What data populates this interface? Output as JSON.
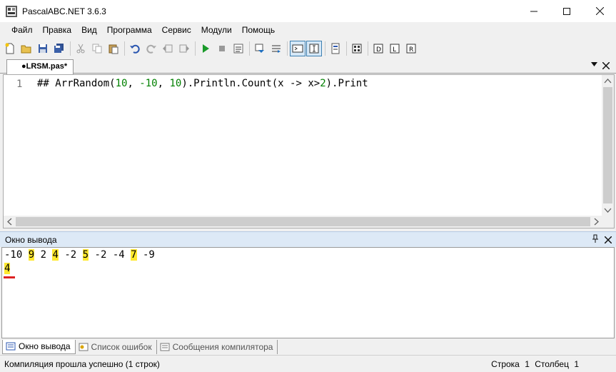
{
  "window": {
    "title": "PascalABC.NET 3.6.3",
    "minimize": "—",
    "maximize": "☐",
    "close": "✕"
  },
  "menu": [
    "Файл",
    "Правка",
    "Вид",
    "Программа",
    "Сервис",
    "Модули",
    "Помощь"
  ],
  "editor": {
    "tab_label": "●LRSM.pas*",
    "line_number": "1",
    "code_prefix": "## ArrRandom(",
    "code_n1": "10",
    "code_mid1": ", ",
    "code_n2": "-10",
    "code_mid2": ", ",
    "code_n3": "10",
    "code_mid3": ").Println.Count(x -> x>",
    "code_n4": "2",
    "code_suffix": ").Print"
  },
  "output": {
    "title": "Окно вывода",
    "line1": [
      {
        "text": "-10",
        "highlight": false
      },
      {
        "text": "9",
        "highlight": true
      },
      {
        "text": "2",
        "highlight": false
      },
      {
        "text": "4",
        "highlight": true
      },
      {
        "text": "-2",
        "highlight": false
      },
      {
        "text": "5",
        "highlight": true
      },
      {
        "text": "-2",
        "highlight": false
      },
      {
        "text": "-4",
        "highlight": false
      },
      {
        "text": "7",
        "highlight": true
      },
      {
        "text": "-9",
        "highlight": false
      }
    ],
    "result": "4"
  },
  "bottom_tabs": {
    "output": "Окно вывода",
    "errors": "Список ошибок",
    "compiler": "Сообщения компилятора"
  },
  "status": {
    "message": "Компиляция прошла успешно (1 строк)",
    "row_label": "Строка",
    "row_value": "1",
    "col_label": "Столбец",
    "col_value": "1"
  },
  "colors": {
    "highlight": "#ffe92e",
    "output_header": "#dde9f6",
    "code_number": "#008000"
  }
}
